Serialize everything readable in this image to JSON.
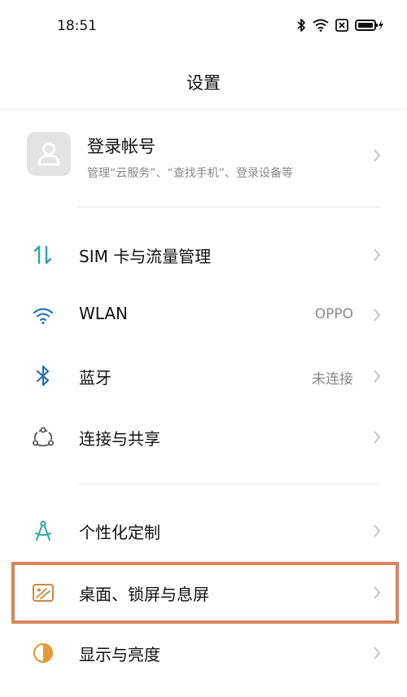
{
  "status_bar": {
    "time": "18:51",
    "icons": [
      "bluetooth-icon",
      "wifi-icon",
      "sim-off-icon",
      "battery-charging-icon"
    ]
  },
  "header": {
    "title": "设置"
  },
  "account": {
    "title": "登录帐号",
    "subtitle": "管理“云服务”、“查找手机”、登录设备等"
  },
  "settings": {
    "sim": {
      "label": "SIM 卡与流量管理",
      "icon": "data-arrows-icon"
    },
    "wlan": {
      "label": "WLAN",
      "value": "OPPO",
      "icon": "wifi-icon"
    },
    "bluetooth": {
      "label": "蓝牙",
      "value": "未连接",
      "icon": "bluetooth-icon"
    },
    "connect": {
      "label": "连接与共享",
      "icon": "share-connect-icon"
    },
    "personalize": {
      "label": "个性化定制",
      "icon": "compass-icon"
    },
    "desktop": {
      "label": "桌面、锁屏与息屏",
      "icon": "wallpaper-icon"
    },
    "display": {
      "label": "显示与亮度",
      "icon": "brightness-icon"
    }
  },
  "colors": {
    "icon_accent": "#2aa9a0",
    "highlight_border": "#d9835a",
    "secondary_text": "#888888"
  }
}
